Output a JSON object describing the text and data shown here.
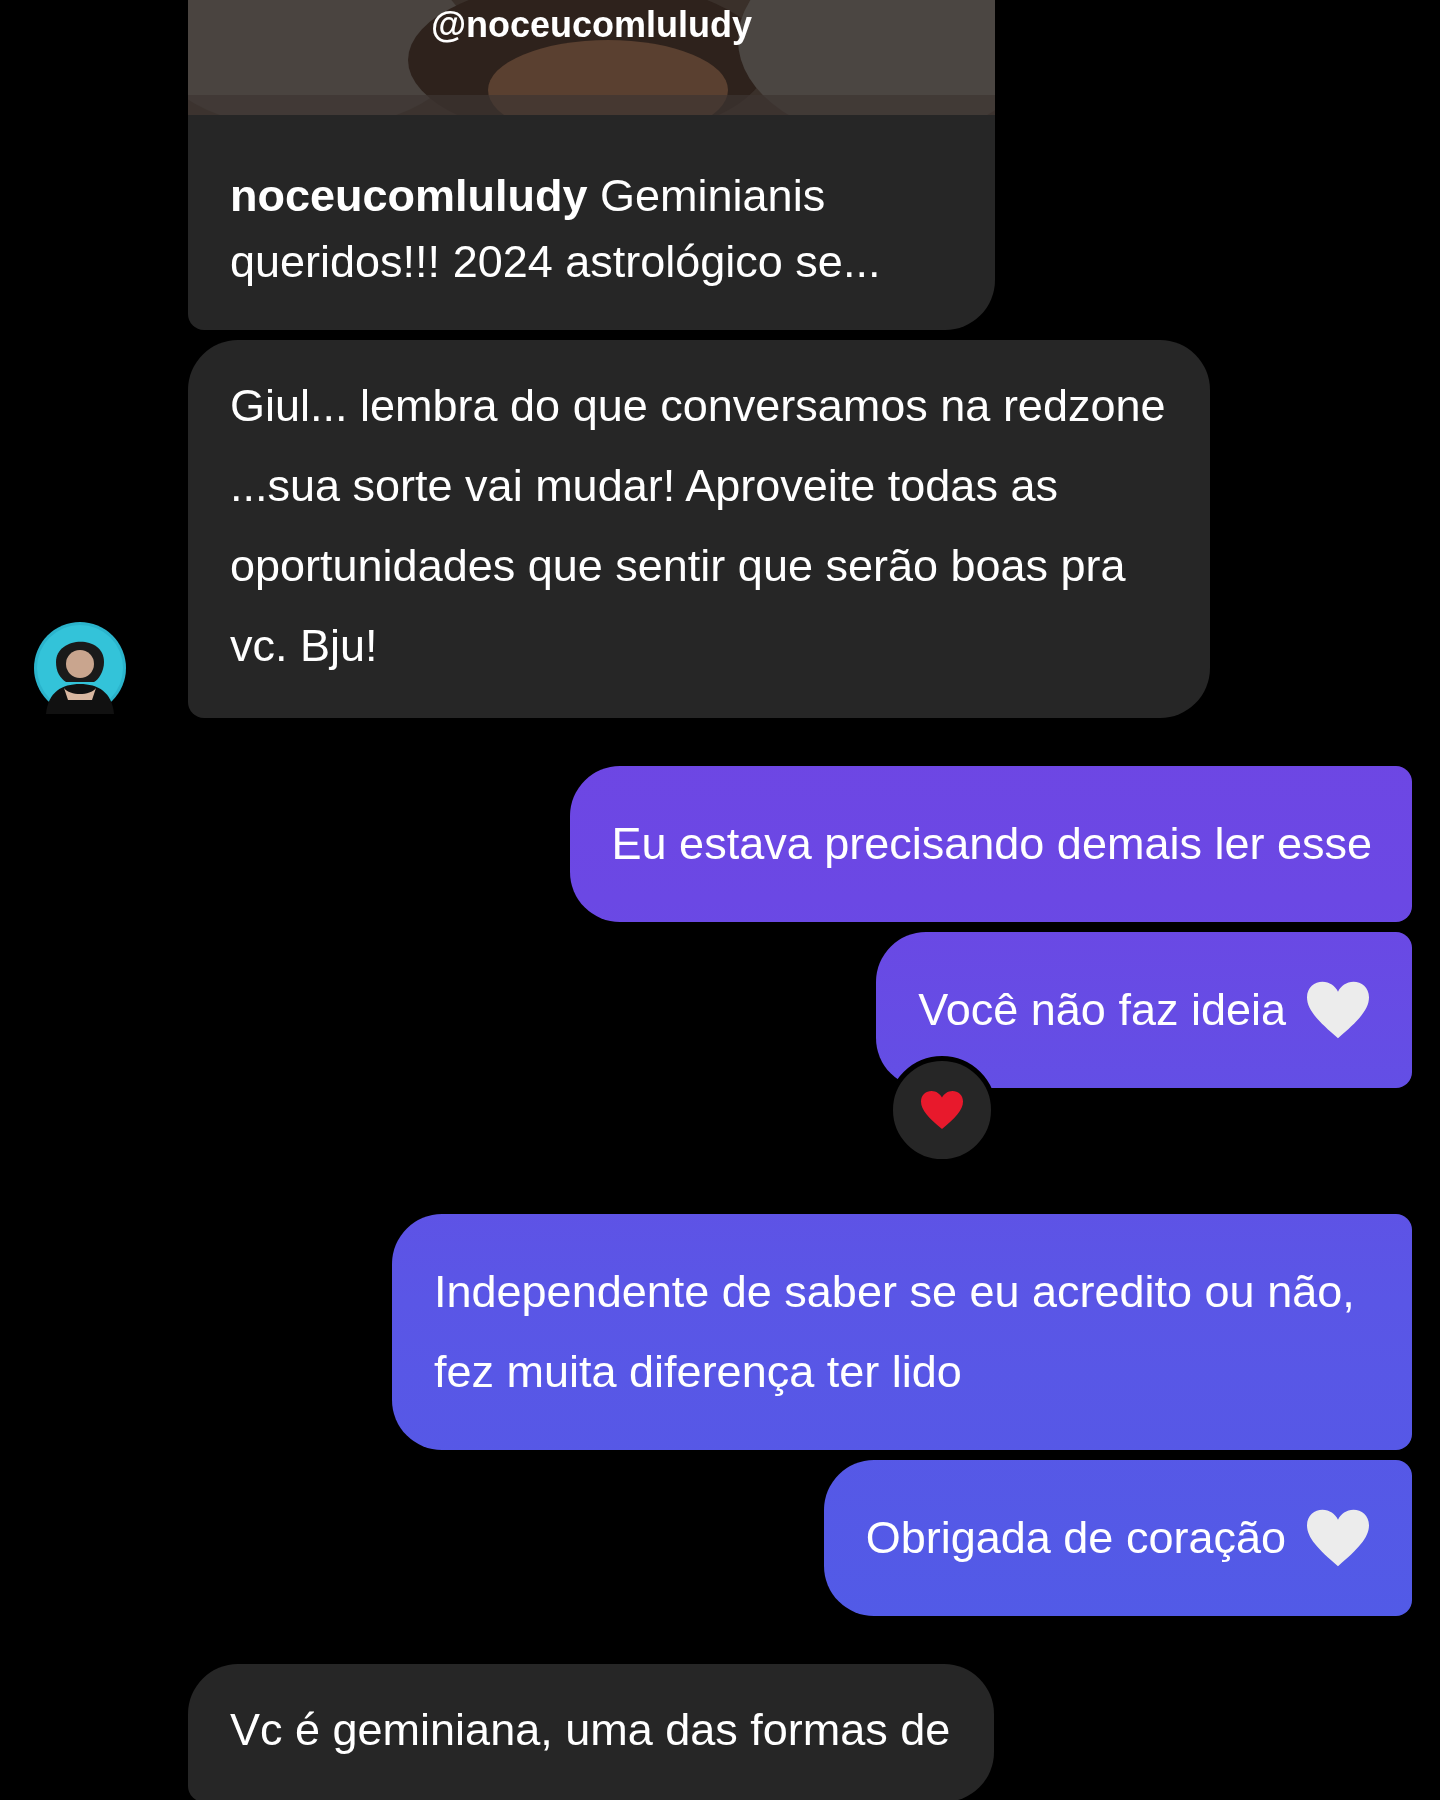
{
  "shared_post": {
    "overlay_handle": "@noceucomluludy",
    "author": "noceucomluludy",
    "caption": "Geminianis queridos!!! 2024 astrológico se..."
  },
  "messages": [
    {
      "kind": "received",
      "text": "Giul... lembra do que conversamos na redzone ...sua sorte vai mudar! Aproveite todas as oportunidades que sentir que serão boas pra vc. Bju!",
      "avatar": true
    },
    {
      "kind": "sent",
      "text": "Eu estava precisando demais ler esse"
    },
    {
      "kind": "sent",
      "text": "Você não faz ideia",
      "heart_emoji": true,
      "heart_reaction": true
    },
    {
      "kind": "sent",
      "text": "Independente de saber se eu acredito ou não, fez muita diferença ter lido"
    },
    {
      "kind": "sent",
      "text": "Obrigada de coração",
      "heart_emoji": true
    },
    {
      "kind": "received",
      "text": "Vc é geminiana, uma das formas de",
      "avatar": false
    }
  ]
}
